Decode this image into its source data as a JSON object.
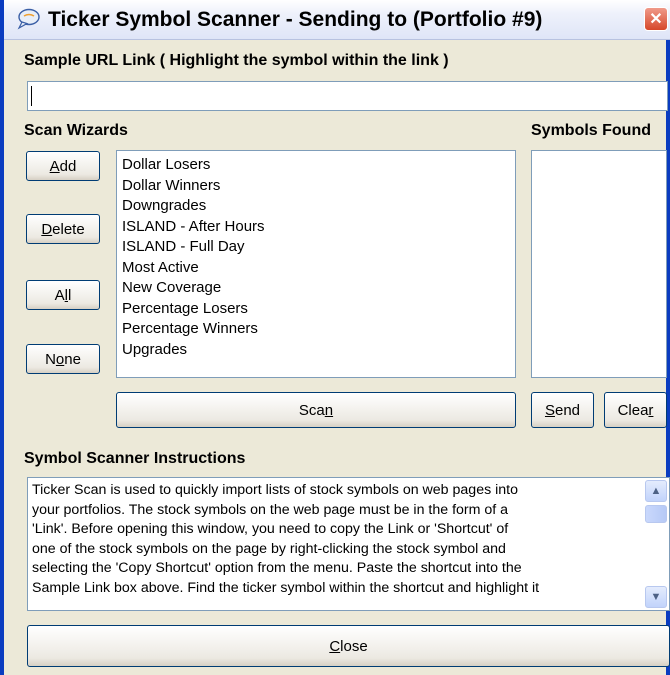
{
  "window": {
    "title": "Ticker Symbol Scanner  -  Sending to (Portfolio #9)",
    "icon": "chat-bubble-icon",
    "close_glyph": "✕"
  },
  "url_section": {
    "label": "Sample URL Link ( Highlight the symbol within the link )",
    "value": ""
  },
  "wizards": {
    "label": "Scan Wizards",
    "buttons": {
      "add": {
        "before": "",
        "mnemonic": "A",
        "after": "dd"
      },
      "delete": {
        "before": "",
        "mnemonic": "D",
        "after": "elete"
      },
      "all": {
        "before": "A",
        "mnemonic": "l",
        "after": "l"
      },
      "none": {
        "before": "N",
        "mnemonic": "o",
        "after": "ne"
      }
    },
    "items": [
      "Dollar Losers",
      "Dollar Winners",
      "Downgrades",
      "ISLAND - After Hours",
      "ISLAND - Full Day",
      "Most Active",
      "New Coverage",
      "Percentage Losers",
      "Percentage Winners",
      "Upgrades"
    ]
  },
  "symbols": {
    "label": "Symbols Found",
    "items": []
  },
  "actions": {
    "scan": {
      "before": "Sca",
      "mnemonic": "n",
      "after": ""
    },
    "send": {
      "before": "",
      "mnemonic": "S",
      "after": "end"
    },
    "clear": {
      "before": "Clea",
      "mnemonic": "r",
      "after": ""
    }
  },
  "instructions": {
    "label": "Symbol Scanner Instructions",
    "lines": [
      "Ticker Scan is used to quickly import lists of stock symbols on web pages into",
      "your portfolios.  The stock symbols on the web page must be in the form of a",
      "'Link'.  Before opening this window, you need to copy the Link or 'Shortcut' of",
      "one of the stock symbols on the page by right-clicking the stock symbol and",
      "selecting the 'Copy Shortcut' option from the menu.  Paste the shortcut into the",
      "Sample Link box above.  Find the ticker symbol within the shortcut and highlight it"
    ]
  },
  "footer": {
    "close": {
      "before": "",
      "mnemonic": "C",
      "after": "lose"
    }
  },
  "colors": {
    "face": "#ece9d8",
    "frame": "#0a3cc0",
    "close_red": "#d6472a"
  }
}
